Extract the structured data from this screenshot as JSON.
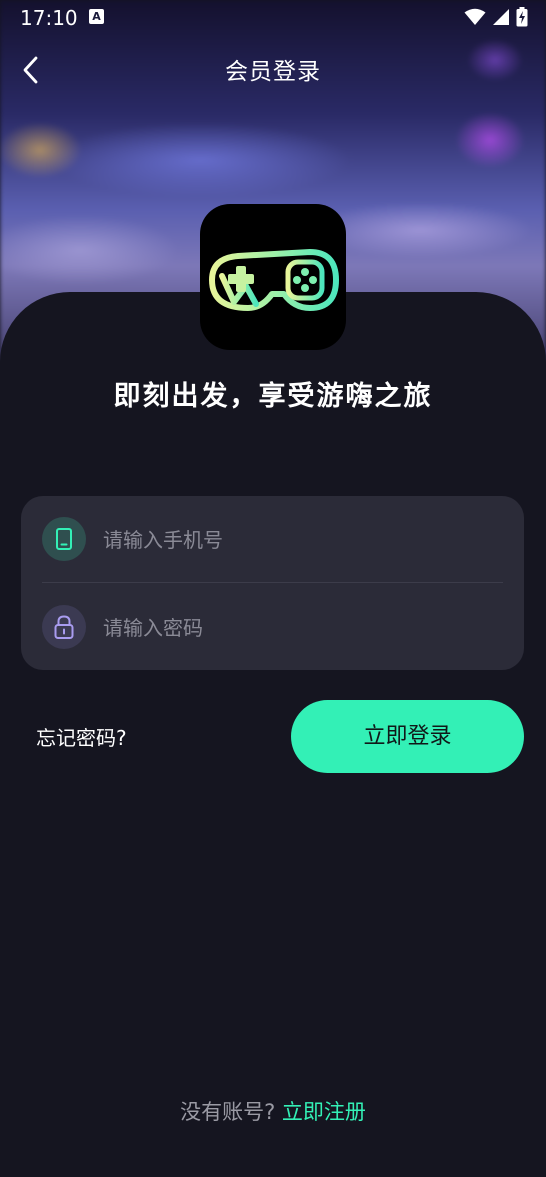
{
  "status_bar": {
    "time": "17:10",
    "notification_icon": "a-icon",
    "icons": [
      "wifi-icon",
      "signal-icon",
      "battery-icon"
    ]
  },
  "nav": {
    "back_icon": "chevron-left-icon",
    "title": "会员登录"
  },
  "logo": {
    "icon": "gamepad-icon"
  },
  "slogan": "即刻出发，享受游嗨之旅",
  "form": {
    "phone": {
      "icon": "phone-icon",
      "placeholder": "请输入手机号",
      "value": ""
    },
    "password": {
      "icon": "lock-icon",
      "placeholder": "请输入密码",
      "value": ""
    }
  },
  "actions": {
    "forgot_label": "忘记密码?",
    "login_label": "立即登录"
  },
  "footer": {
    "prompt": "没有账号?",
    "register_label": "立即注册"
  },
  "colors": {
    "accent": "#33f0b6",
    "background": "#151520",
    "card": "#2b2b38"
  }
}
